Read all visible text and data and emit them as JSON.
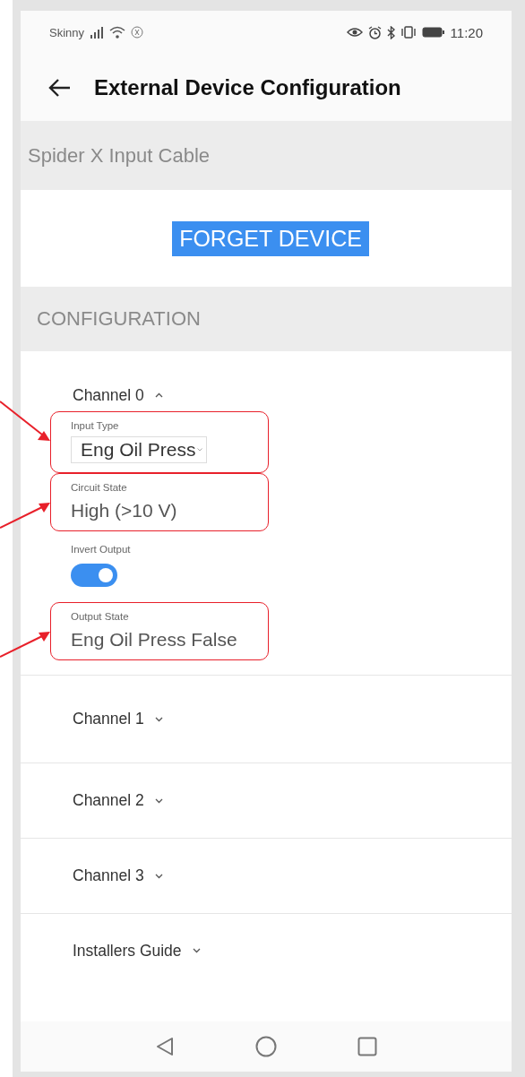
{
  "status_bar": {
    "carrier": "Skinny",
    "time": "11:20"
  },
  "header": {
    "title": "External Device Configuration"
  },
  "device": {
    "name": "Spider X Input Cable",
    "button": "FORGET DEVICE"
  },
  "section": {
    "title": "CONFIGURATION"
  },
  "accordions": [
    {
      "label": "Channel 0",
      "expanded": true,
      "fields": [
        {
          "kind": "select",
          "label": "Input Type",
          "value": "Eng Oil Press",
          "highlighted": true
        },
        {
          "kind": "readout",
          "label": "Circuit State",
          "value": "High (>10 V)",
          "highlighted": true
        },
        {
          "kind": "toggle",
          "label": "Invert Output",
          "on": true,
          "highlighted": false
        },
        {
          "kind": "readout",
          "label": "Output State",
          "value": "Eng Oil Press False",
          "highlighted": true
        }
      ]
    },
    {
      "label": "Channel 1",
      "expanded": false
    },
    {
      "label": "Channel 2",
      "expanded": false
    },
    {
      "label": "Channel 3",
      "expanded": false
    },
    {
      "label": "Installers Guide",
      "expanded": false
    }
  ]
}
